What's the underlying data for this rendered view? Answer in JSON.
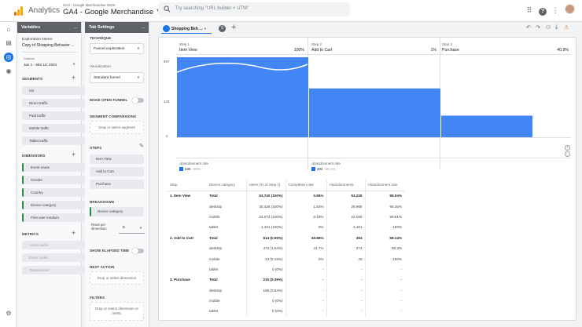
{
  "header": {
    "app_title": "Analytics",
    "account_line": "GA4 - Google Merchandise Store",
    "property": "GA4 - Google Merchandise ...",
    "search_placeholder": "Try searching \"URL builder + UTM\""
  },
  "variables": {
    "title": "Variables",
    "exploration_label": "Exploration Name:",
    "exploration_name": "Copy of Shopping Behavior ...",
    "dates_label": "Custom",
    "dates_value": "Jan 1 - Mar 14, 2022",
    "segments_title": "SEGMENTS",
    "segments": [
      "US",
      "Direct traffic",
      "Paid traffic",
      "Mobile traffic",
      "Tablet traffic"
    ],
    "dimensions_title": "DIMENSIONS",
    "dimensions": [
      "Event name",
      "Gender",
      "Country",
      "Device category",
      "First user medium"
    ],
    "metrics_title": "METRICS",
    "metrics": [
      "Active users",
      "Event count",
      "Transactions"
    ]
  },
  "tab_settings": {
    "title": "Tab Settings",
    "technique_label": "TECHNIQUE",
    "technique": "Funnel exploration",
    "visualization_label": "Visualization",
    "visualization": "Standard funnel",
    "open_funnel_label": "MAKE OPEN FUNNEL",
    "segment_comparisons_label": "SEGMENT COMPARISONS",
    "segment_drop": "Drop or select segment",
    "steps_label": "STEPS",
    "steps": [
      "Item View",
      "Add to Cart",
      "Purchase"
    ],
    "breakdown_label": "BREAKDOWN",
    "breakdown": "Device category",
    "rows_label": "Rows per dimension",
    "rows_value": "5",
    "elapsed_label": "SHOW ELAPSED TIME",
    "next_action_label": "NEXT ACTION",
    "next_action_drop": "Drop or select dimension",
    "filters_label": "FILTERS",
    "filters_drop": "Drop or select dimension or metric"
  },
  "tabs": {
    "active": "Shopping Beh ...",
    "second": "S"
  },
  "funnel": {
    "y_ticks": [
      "997",
      "429",
      "0"
    ],
    "abandon_caption": "Abandonment rate",
    "steps": [
      {
        "number": "Step 1",
        "name": "Item View",
        "percent": "100%",
        "abandon_count": "53K",
        "abandon_rate": "99%"
      },
      {
        "number": "Step 2",
        "name": "Add to Cart",
        "percent": "1%",
        "abandon_count": "304",
        "abandon_rate": "59.1%"
      },
      {
        "number": "Step 3",
        "name": "Purchase",
        "percent": "40.9%"
      }
    ]
  },
  "chart_data": {
    "type": "bar",
    "categories": [
      "Item View",
      "Add to Cart",
      "Purchase"
    ],
    "values": [
      100,
      1,
      40.9
    ],
    "ylabel": "",
    "y_ticks": [
      0,
      429,
      997
    ],
    "series": [
      {
        "values": [
          100,
          1,
          40.9
        ]
      }
    ]
  },
  "table": {
    "headers": [
      "Step",
      "Device category",
      "Users (% of Step 1)",
      "Completion rate",
      "Abandonments",
      "Abandonment rate"
    ],
    "rows": [
      [
        "1. Item View",
        "Total",
        "53,740 (100%)",
        "0.96%",
        "53,226",
        "99.04%"
      ],
      [
        "",
        "desktop",
        "30,436 (100%)",
        "1.54%",
        "29,968",
        "98.46%"
      ],
      [
        "",
        "mobile",
        "22,072 (100%)",
        "0.19%",
        "22,029",
        "99.81%"
      ],
      [
        "",
        "tablet",
        "1,101 (100%)",
        "0%",
        "1,101",
        "100%"
      ],
      [
        "2. Add to Cart",
        "Total",
        "514 (0.96%)",
        "40.86%",
        "304",
        "59.14%"
      ],
      [
        "",
        "desktop",
        "470 (1.54%)",
        "41.7%",
        "274",
        "58.3%"
      ],
      [
        "",
        "mobile",
        "43 (0.19%)",
        "0%",
        "43",
        "100%"
      ],
      [
        "",
        "tablet",
        "0 (0%)",
        "-",
        "-",
        "-"
      ],
      [
        "3. Purchase",
        "Total",
        "210 (0.39%)",
        "-",
        "-",
        "-"
      ],
      [
        "",
        "desktop",
        "196 (0.64%)",
        "-",
        "-",
        "-"
      ],
      [
        "",
        "mobile",
        "0 (0%)",
        "-",
        "-",
        "-"
      ],
      [
        "",
        "tablet",
        "0 (0%)",
        "-",
        "-",
        "-"
      ]
    ]
  },
  "colors": {
    "accent": "#1a73e8",
    "bar": "#4285f4",
    "panel_header": "#5f6368"
  }
}
